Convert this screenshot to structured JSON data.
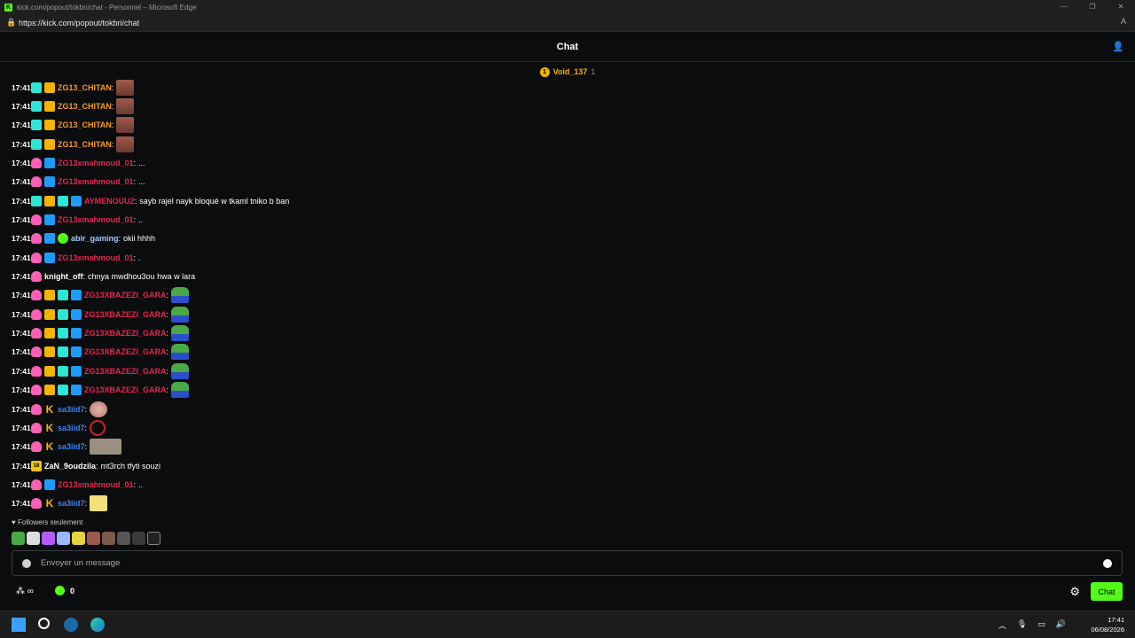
{
  "browser": {
    "window_title": "kick.com/popout/tokbri/chat - Personnel – Microsoft Edge",
    "url": "https://kick.com/popout/tokbri/chat",
    "reader_icon": "read-aloud-icon"
  },
  "header": {
    "title": "Chat"
  },
  "pinned": {
    "name": "Void_137",
    "count": "1"
  },
  "messages": [
    {
      "time": "17:41",
      "badges": [
        "teal",
        "crown"
      ],
      "user": "ZG13_CHITAN",
      "color": "#f59a23",
      "text": "",
      "emote": "face"
    },
    {
      "time": "17:41",
      "badges": [
        "teal",
        "crown"
      ],
      "user": "ZG13_CHITAN",
      "color": "#f59a23",
      "text": "",
      "emote": "face"
    },
    {
      "time": "17:41",
      "badges": [
        "teal",
        "crown"
      ],
      "user": "ZG13_CHITAN",
      "color": "#f59a23",
      "text": "",
      "emote": "face"
    },
    {
      "time": "17:41",
      "badges": [
        "teal",
        "crown"
      ],
      "user": "ZG13_CHITAN",
      "color": "#f59a23",
      "text": "",
      "emote": "face"
    },
    {
      "time": "17:41",
      "badges": [
        "pink",
        "arrow"
      ],
      "user": "ZG13xmahmoud_01",
      "color": "#e8244e",
      "text": "...",
      "emote": ""
    },
    {
      "time": "17:41",
      "badges": [
        "pink",
        "arrow"
      ],
      "user": "ZG13xmahmoud_01",
      "color": "#e8244e",
      "text": "...",
      "emote": ""
    },
    {
      "time": "17:41",
      "badges": [
        "teal",
        "crown",
        "gift",
        "arrow"
      ],
      "user": "AYMENOUU2",
      "color": "#e8244e",
      "text": "sayb rajel nayk bloqué w tkaml tniko b ban",
      "emote": ""
    },
    {
      "time": "17:41",
      "badges": [
        "pink",
        "arrow"
      ],
      "user": "ZG13xmahmoud_01",
      "color": "#e8244e",
      "text": "..",
      "emote": ""
    },
    {
      "time": "17:41",
      "badges": [
        "pink",
        "arrow",
        "green"
      ],
      "user": "abir_gaming",
      "color": "#a6c8ff",
      "text": "okii hhhh",
      "emote": ""
    },
    {
      "time": "17:41",
      "badges": [
        "pink",
        "arrow"
      ],
      "user": "ZG13xmahmoud_01",
      "color": "#e8244e",
      "text": ".",
      "emote": ""
    },
    {
      "time": "17:41",
      "badges": [
        "pink"
      ],
      "user": "knight_off",
      "color": "#ffffff",
      "text": "chnya mwdhou3ou hwa w lara",
      "emote": ""
    },
    {
      "time": "17:41",
      "badges": [
        "pink",
        "crown",
        "gift",
        "arrow"
      ],
      "user": "ZG13XBAZEZI_GARA",
      "color": "#e8244e",
      "text": "",
      "emote": "pepe"
    },
    {
      "time": "17:41",
      "badges": [
        "pink",
        "crown",
        "gift",
        "arrow"
      ],
      "user": "ZG13XBAZEZI_GARA",
      "color": "#e8244e",
      "text": "",
      "emote": "pepe"
    },
    {
      "time": "17:41",
      "badges": [
        "pink",
        "crown",
        "gift",
        "arrow"
      ],
      "user": "ZG13XBAZEZI_GARA",
      "color": "#e8244e",
      "text": "",
      "emote": "pepe"
    },
    {
      "time": "17:41",
      "badges": [
        "pink",
        "crown",
        "gift",
        "arrow"
      ],
      "user": "ZG13XBAZEZI_GARA",
      "color": "#e8244e",
      "text": "",
      "emote": "pepe"
    },
    {
      "time": "17:41",
      "badges": [
        "pink",
        "crown",
        "gift",
        "arrow"
      ],
      "user": "ZG13XBAZEZI_GARA",
      "color": "#e8244e",
      "text": "",
      "emote": "pepe"
    },
    {
      "time": "17:41",
      "badges": [
        "pink",
        "crown",
        "gift",
        "arrow"
      ],
      "user": "ZG13XBAZEZI_GARA",
      "color": "#e8244e",
      "text": "",
      "emote": "pepe"
    },
    {
      "time": "17:41",
      "badges": [
        "pink",
        "k"
      ],
      "user": "sa3iid7",
      "color": "#3b82f6",
      "text": "",
      "emote": "round"
    },
    {
      "time": "17:41",
      "badges": [
        "pink",
        "k"
      ],
      "user": "sa3iid7",
      "color": "#3b82f6",
      "text": "",
      "emote": "red"
    },
    {
      "time": "17:41",
      "badges": [
        "pink",
        "k"
      ],
      "user": "sa3iid7",
      "color": "#3b82f6",
      "text": "",
      "emote": "whc"
    },
    {
      "time": "17:41",
      "badges": [
        "gold"
      ],
      "user": "ZaN_9oudzila",
      "color": "#ffffff",
      "text": "mt3rch tfyti souzi",
      "emote": ""
    },
    {
      "time": "17:41",
      "badges": [
        "pink",
        "arrow"
      ],
      "user": "ZG13xmahmoud_01",
      "color": "#e8244e",
      "text": "..",
      "emote": ""
    },
    {
      "time": "17:41",
      "badges": [
        "pink",
        "k"
      ],
      "user": "sa3iid7",
      "color": "#3b82f6",
      "text": "",
      "emote": "yellow"
    }
  ],
  "badge_labels": {
    "teal": "",
    "pink": "",
    "crown": "",
    "gift": "",
    "arrow": "",
    "green": "",
    "k": "K",
    "gold": "18"
  },
  "followers_label": "Followers seulement",
  "input": {
    "placeholder": "Envoyer un message"
  },
  "bottom": {
    "points": "∞",
    "green_points": "0",
    "chat_button": "Chat"
  },
  "taskbar": {
    "time": "17:41",
    "date": "06/08/2026"
  },
  "colors": {
    "kick_green": "#53fc18",
    "background": "#0b0c0d"
  }
}
